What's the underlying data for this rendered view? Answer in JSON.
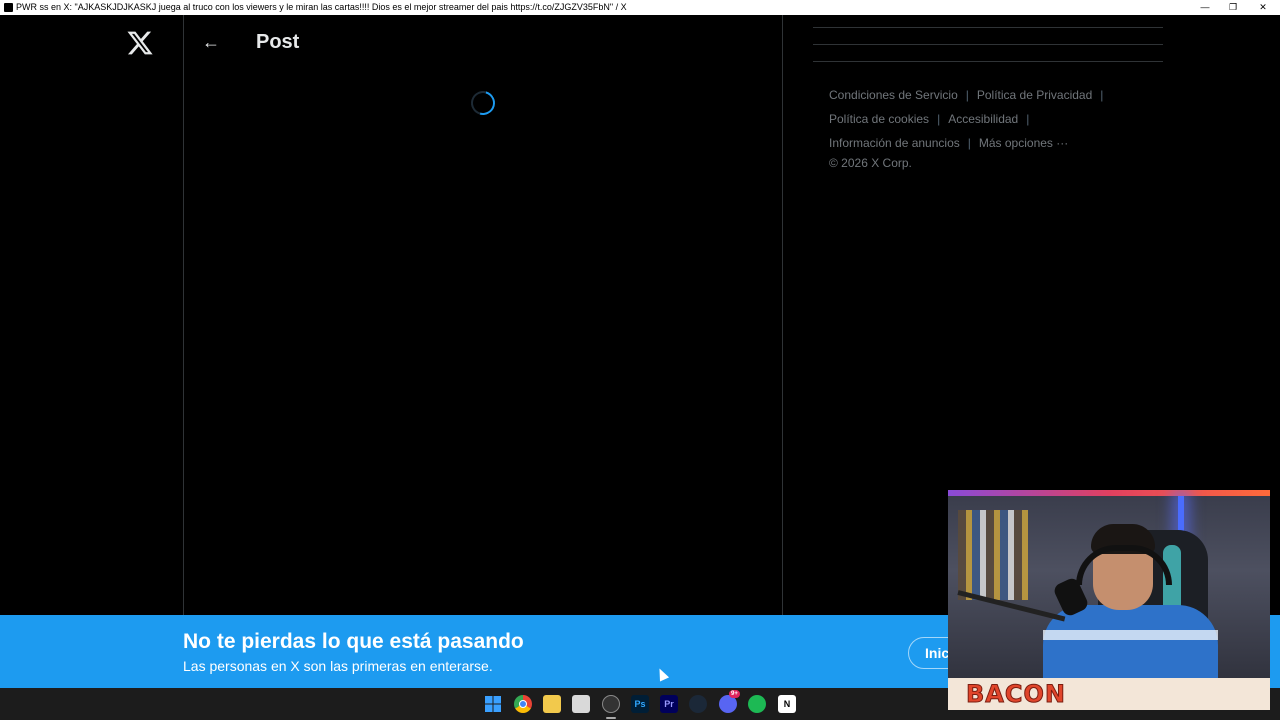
{
  "window": {
    "title": "PWR ss en X: \"AJKASKJDJKASKJ juega al truco con los viewers y le miran las cartas!!!! Dios es el mejor streamer del pais https://t.co/ZJGZV35FbN\" / X",
    "minimize_glyph": "—",
    "restore_glyph": "❐",
    "close_glyph": "✕"
  },
  "nav": {
    "logo": "x-logo-icon"
  },
  "main": {
    "back_glyph": "←",
    "title": "Post"
  },
  "footer": {
    "rows": [
      [
        "Condiciones de Servicio",
        "Política de Privacidad"
      ],
      [
        "Política de cookies",
        "Accesibilidad"
      ],
      [
        "Información de anuncios",
        "Más opciones ···"
      ]
    ],
    "separator": "|",
    "copyright": "© 2026 X Corp."
  },
  "banner": {
    "title": "No te pierdas lo que está pasando",
    "subtitle": "Las personas en X son las primeras en enterarse.",
    "login_label": "Iniciar sesión"
  },
  "webcam": {
    "name": "BACON"
  },
  "taskbar": {
    "icons": [
      "windows-start-icon",
      "chrome-icon",
      "file-explorer-icon",
      "snipping-tool-icon",
      "obs-icon",
      "photoshop-icon",
      "premiere-icon",
      "steam-icon",
      "discord-icon",
      "spotify-icon",
      "notion-icon"
    ],
    "photoshop_label": "Ps",
    "premiere_label": "Pr",
    "notion_label": "N",
    "discord_badge": "9+"
  },
  "colors": {
    "accent": "#1d9bf0",
    "background": "#000000",
    "border": "#2f3336",
    "muted_text": "#71767b"
  }
}
